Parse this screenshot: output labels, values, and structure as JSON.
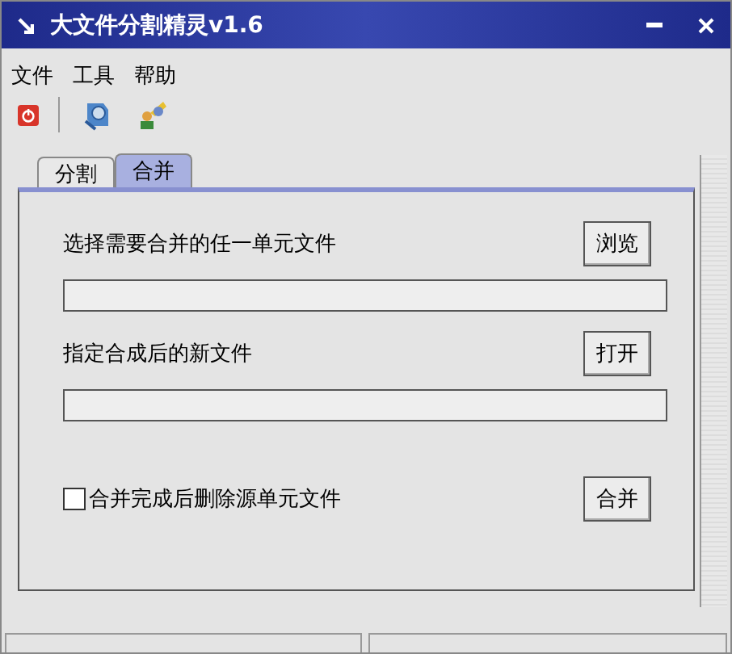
{
  "window": {
    "title": "大文件分割精灵v1.6"
  },
  "menu": [
    "文件",
    "工具",
    "帮助"
  ],
  "tabs": [
    {
      "label": "分割",
      "selected": false
    },
    {
      "label": "合并",
      "selected": true
    }
  ],
  "merge": {
    "source_label": "选择需要合并的任一单元文件",
    "browse_button": "浏览",
    "target_label": "指定合成后的新文件",
    "open_button": "打开",
    "delete_source": {
      "label": "合并完成后删除源单元文件",
      "checked": false
    },
    "merge_button": "合并"
  }
}
